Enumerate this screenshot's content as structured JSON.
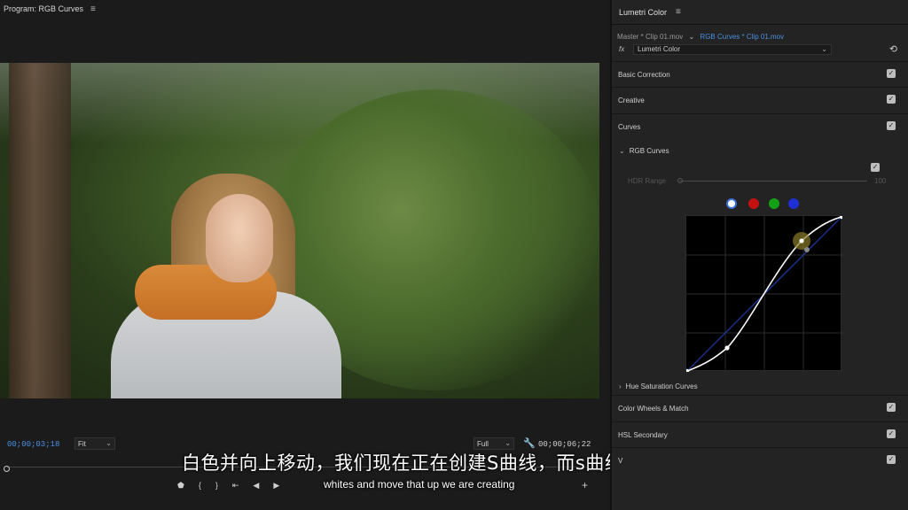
{
  "program": {
    "title": "Program: RGB Curves",
    "menu_icon": "hamburger-icon",
    "current_timecode": "00;00;03;18",
    "fit_value": "Fit",
    "quality_value": "Full",
    "duration_timecode": "00;00;06;22",
    "transport": {
      "marker": "⬟",
      "in": "{",
      "out": "}",
      "goto_in": "⇤",
      "step_back": "◀",
      "play": "▶"
    },
    "add_label": "+"
  },
  "subtitles": {
    "zh": "白色并向上移动，我们现在正在创建S曲线，而s曲线是",
    "en": "whites and move that up we are creating"
  },
  "lumetri": {
    "title": "Lumetri Color",
    "clip_master": "Master * Clip 01.mov",
    "clip_active": "RGB Curves * Clip 01.mov",
    "fx_label": "fx",
    "effect_name": "Lumetri Color",
    "sections": {
      "basic": "Basic Correction",
      "creative": "Creative",
      "curves": "Curves",
      "wheels": "Color Wheels & Match",
      "hsl": "HSL Secondary",
      "vignette": "V"
    },
    "rgb_curves_label": "RGB Curves",
    "hdr_label": "HDR Range",
    "hdr_value": "100",
    "hue_sat_label": "Hue Saturation Curves",
    "check_mark": "✓",
    "channels": {
      "white": "#ffffff",
      "red": "#c41212",
      "green": "#14a014",
      "blue": "#1f2fd6"
    }
  }
}
